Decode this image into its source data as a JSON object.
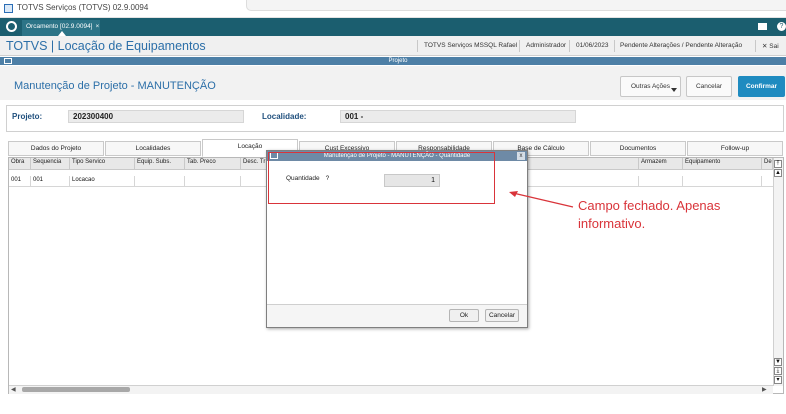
{
  "window": {
    "title": "TOTVS Serviços (TOTVS) 02.9.0094"
  },
  "tabbar": {
    "tab_label": "Orcamento [02.9.0094]",
    "tab_close": "×"
  },
  "app_header": {
    "title": "TOTVS | Locação de Equipamentos",
    "environment": "TOTVS Serviços MSSQL Rafael",
    "user": "Administrador",
    "date": "01/06/2023",
    "pending": "Pendente Alterações / Pendente Alteração",
    "exit": "✕ Sai"
  },
  "window_strip": {
    "title": "Projeto"
  },
  "form": {
    "title": "Manutenção de Projeto - MANUTENÇÃO",
    "buttons": {
      "other_actions": "Outras Ações",
      "cancel": "Cancelar",
      "confirm": "Confirmar"
    },
    "project_label": "Projeto:",
    "project_value": "202300400",
    "locality_label": "Localidade:",
    "locality_value": "001 -"
  },
  "folder_tabs": [
    {
      "label": "Dados do Projeto"
    },
    {
      "label": "Localidades"
    },
    {
      "label": "Locação"
    },
    {
      "label": "Cust Excessivo"
    },
    {
      "label": "Responsabilidade"
    },
    {
      "label": "Base de Cálculo"
    },
    {
      "label": "Documentos"
    },
    {
      "label": "Follow-up"
    }
  ],
  "grid": {
    "columns": [
      "Obra",
      "Sequencia",
      "Tipo Servico",
      "Equip. Subs.",
      "Tab. Preco",
      "Desc. Tr",
      "Armazem",
      "Equipamento",
      "De"
    ],
    "rows": [
      {
        "cells": [
          "001",
          "001",
          "Locacao",
          "",
          "",
          "",
          "",
          "",
          ""
        ]
      }
    ]
  },
  "modal": {
    "title": "Manutenção de Projeto - MANUTENÇÃO - Quantidade",
    "close": "x",
    "field_label": "Quantidade",
    "help": "?",
    "field_value": "1",
    "ok": "Ok",
    "cancel": "Cancelar"
  },
  "annotation": {
    "text": "Campo fechado. Apenas informativo.",
    "color": "#d9343a"
  }
}
